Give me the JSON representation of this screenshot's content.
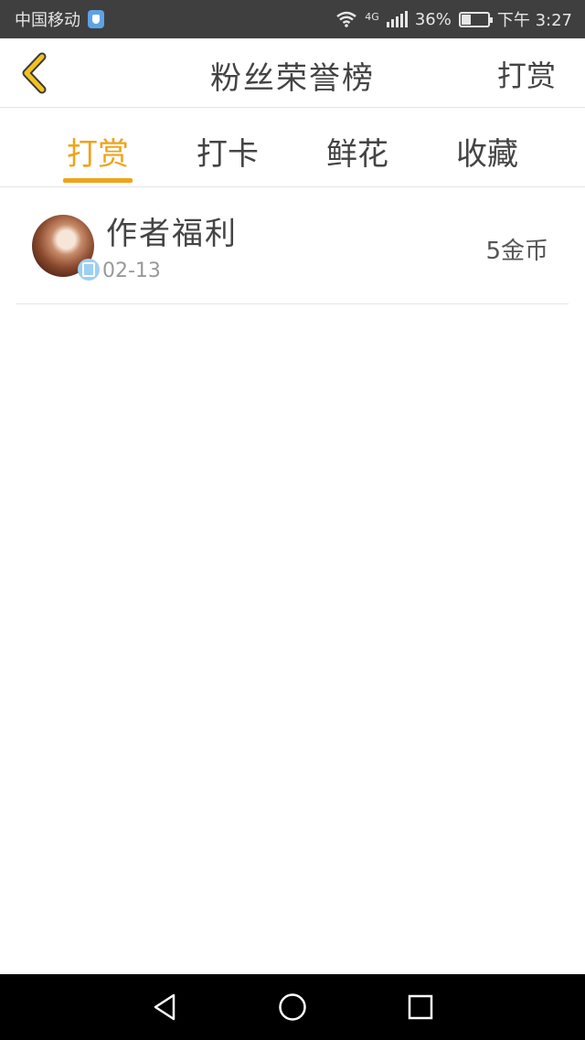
{
  "status_bar": {
    "carrier": "中国移动",
    "network": "4G",
    "battery": "36%",
    "battery_level": 0.36,
    "time": "下午 3:27"
  },
  "header": {
    "title": "粉丝荣誉榜",
    "right_action": "打赏",
    "back_icon": "chevron-left-icon",
    "accent_color": "#f0a31a"
  },
  "tabs": [
    {
      "label": "打赏",
      "active": true
    },
    {
      "label": "打卡",
      "active": false
    },
    {
      "label": "鲜花",
      "active": false
    },
    {
      "label": "收藏",
      "active": false
    }
  ],
  "list": [
    {
      "name": "作者福利",
      "date": "02-13",
      "amount": "5金币",
      "badge_icon": "verified-badge-icon"
    }
  ],
  "nav_bar": {
    "back_icon": "triangle-back-icon",
    "home_icon": "circle-home-icon",
    "recents_icon": "square-recents-icon"
  }
}
